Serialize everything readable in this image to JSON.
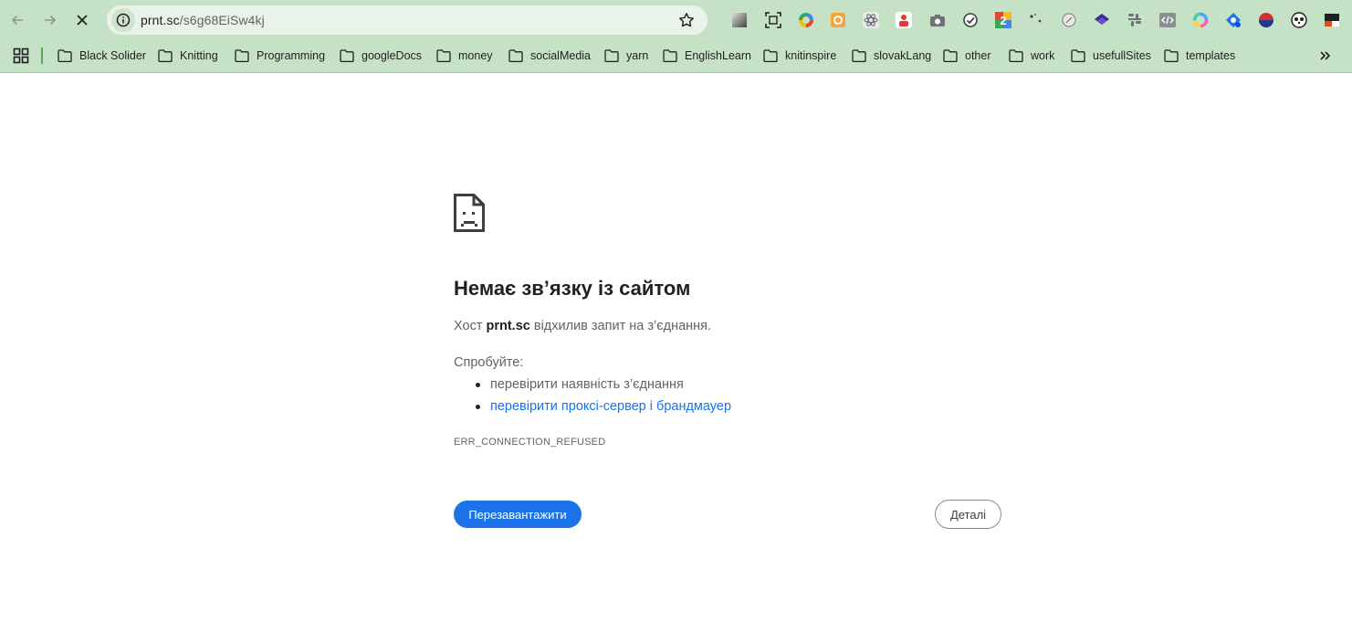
{
  "browser": {
    "address_bar": {
      "host": "prnt.sc",
      "path": "/s6g68EiSw4kj"
    },
    "extensions": [
      "gradient-square-extension-icon",
      "screenshot-frame-extension-icon",
      "color-ring-extension-icon",
      "orange-square-extension-icon",
      "react-atom-extension-icon",
      "people-red-extension-icon",
      "camera-extension-icon",
      "check-circle-extension-icon",
      "number-two-badge-extension-icon",
      "sparkle-dots-extension-icon",
      "compass-extension-icon",
      "purple-layers-extension-icon",
      "slack-grid-extension-icon",
      "code-tag-extension-icon",
      "rainbow-ring-extension-icon",
      "blue-diamond-extension-icon",
      "red-blue-circle-extension-icon",
      "panda-avatar-extension-icon",
      "black-red-flag-extension-icon"
    ]
  },
  "bookmarks": [
    {
      "label": "Black Solider"
    },
    {
      "label": "Knitting"
    },
    {
      "label": "Programming"
    },
    {
      "label": "googleDocs"
    },
    {
      "label": "money"
    },
    {
      "label": "socialMedia"
    },
    {
      "label": "yarn"
    },
    {
      "label": "EnglishLearn"
    },
    {
      "label": "knitinspire"
    },
    {
      "label": "slovakLang"
    },
    {
      "label": "other"
    },
    {
      "label": "work"
    },
    {
      "label": "usefullSites"
    },
    {
      "label": "templates"
    }
  ],
  "error": {
    "title": "Немає зв’язку із сайтом",
    "summary_prefix": "Хост",
    "summary_host": "prnt.sc",
    "summary_suffix": "відхилив запит на з’єднання.",
    "try_label": "Спробуйте:",
    "suggestions": [
      {
        "text": "перевірити наявність з’єднання"
      },
      {
        "text": "перевірити проксі-сервер і брандмауер"
      }
    ],
    "code": "ERR_CONNECTION_REFUSED",
    "reload_label": "Перезавантажити",
    "details_label": "Деталі"
  },
  "colors": {
    "toolbar_bg": "#c6e2c6",
    "primary_button": "#1a73e8",
    "link": "#1a73e8"
  }
}
